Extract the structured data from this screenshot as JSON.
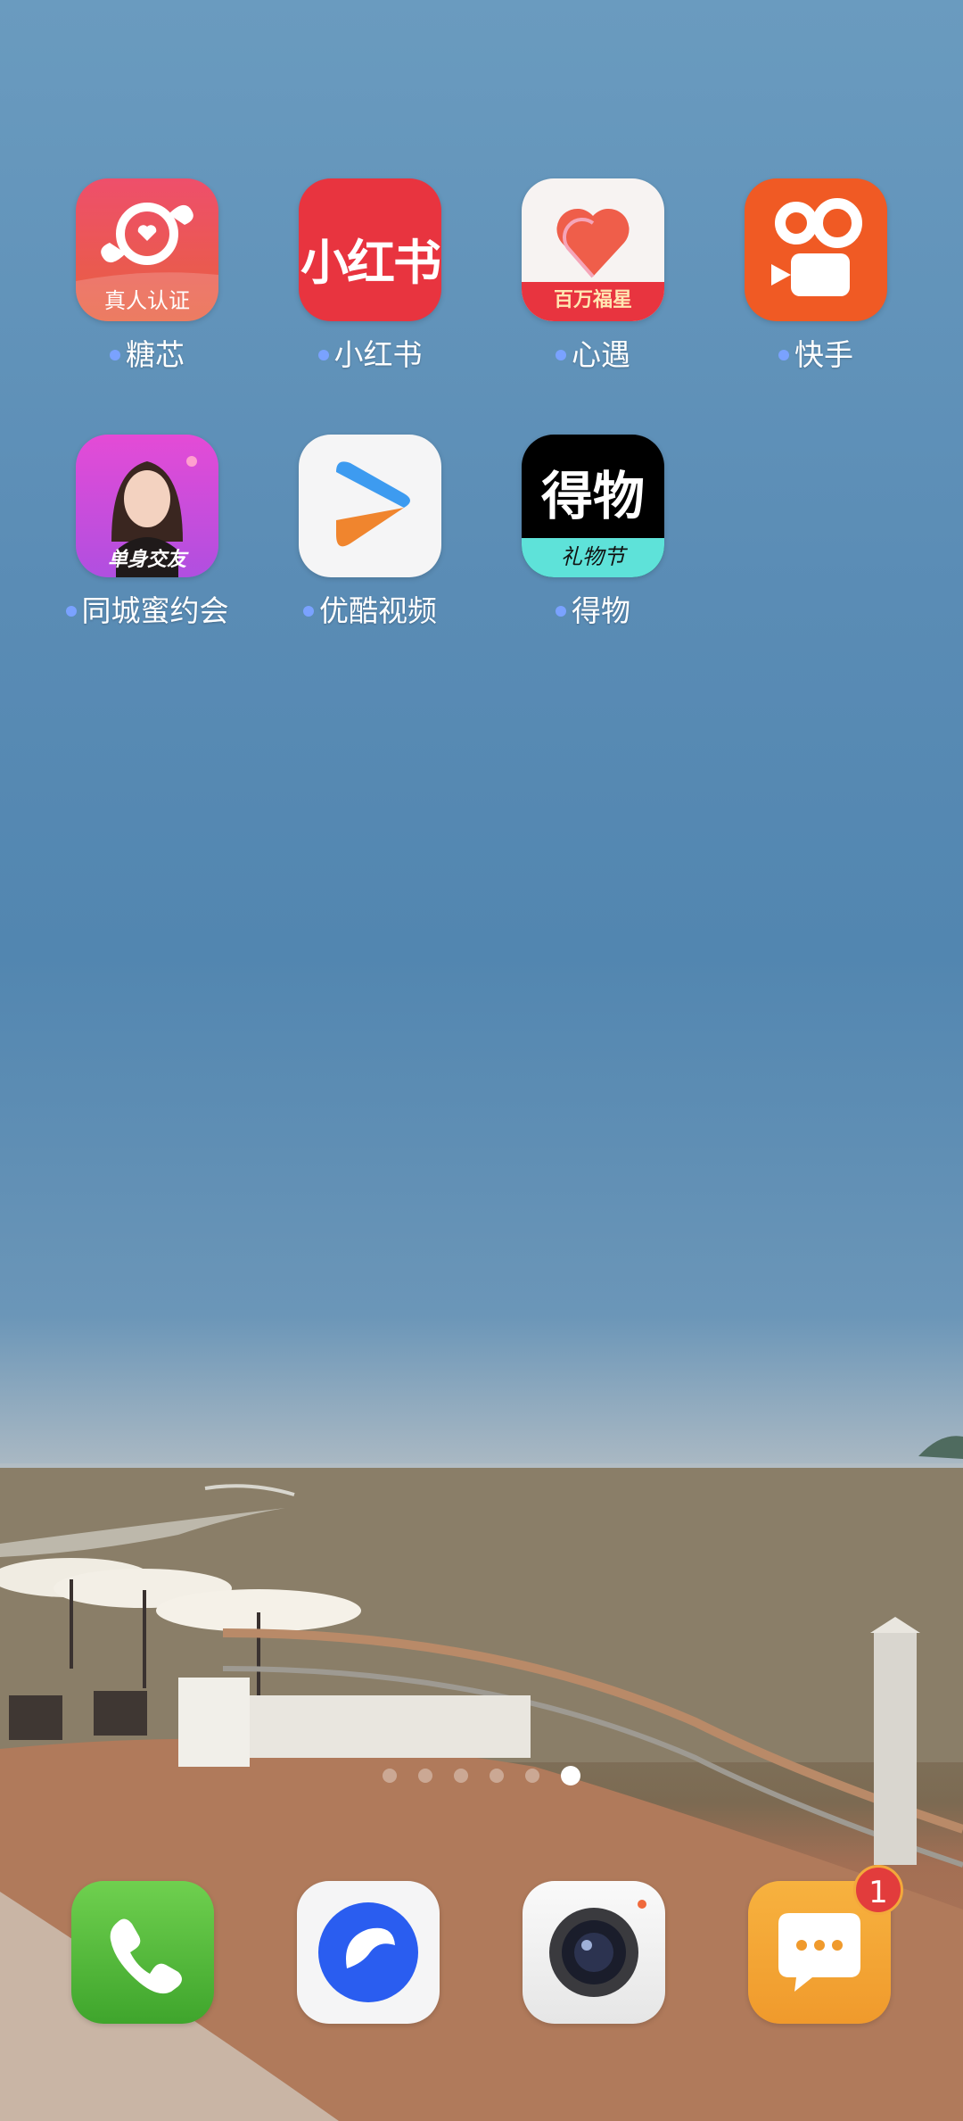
{
  "home": {
    "apps": [
      {
        "name": "糖芯",
        "icon": "heart-candy-icon",
        "caption": "真人认证",
        "has_update_dot": true
      },
      {
        "name": "小红书",
        "icon": "xiaohongshu-logo-icon",
        "logo_text": "小红书",
        "has_update_dot": true
      },
      {
        "name": "心遇",
        "icon": "heart-tag-icon",
        "caption": "百万福星",
        "has_update_dot": true
      },
      {
        "name": "快手",
        "icon": "kuaishou-camera-icon",
        "has_update_dot": true
      },
      {
        "name": "同城蜜约会",
        "icon": "avatar-portrait-icon",
        "caption": "单身交友",
        "has_update_dot": true
      },
      {
        "name": "优酷视频",
        "icon": "youku-play-icon",
        "has_update_dot": true
      },
      {
        "name": "得物",
        "icon": "dewu-logo-icon",
        "logo_text": "得物",
        "caption": "礼物节",
        "has_update_dot": true
      }
    ]
  },
  "page_indicator": {
    "count": 6,
    "active_index": 5
  },
  "dock": [
    {
      "name": "phone",
      "icon": "phone-icon"
    },
    {
      "name": "browser",
      "icon": "browser-icon"
    },
    {
      "name": "camera",
      "icon": "camera-icon"
    },
    {
      "name": "messages",
      "icon": "chat-bubble-icon",
      "badge": "1"
    }
  ],
  "colors": {
    "sky_top": "#6a9bbf",
    "update_dot": "#7aa2ff",
    "tangxin": "#e84a5f",
    "xiaohongshu": "#e8343f",
    "kuaishou": "#f05a24",
    "dewu": "#000000",
    "phone": "#4db33a",
    "browser": "#2a5df0",
    "messages": "#f3a83b",
    "badge": "#e23c3c"
  }
}
